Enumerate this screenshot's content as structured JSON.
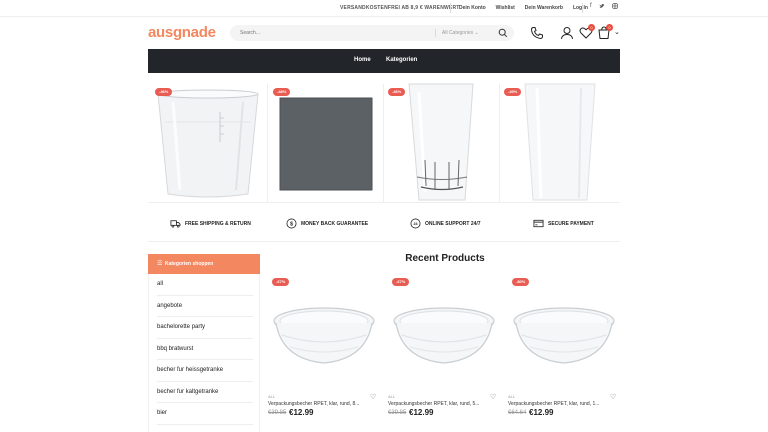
{
  "topbar": {
    "promo": "VERSANDKOSTENFREI AB 8,9 € WARENWERT",
    "links": [
      "Dein Konto",
      "Wishlist",
      "Dein Warenkorb",
      "Log In"
    ],
    "social": [
      "f",
      "t",
      "ig"
    ]
  },
  "header": {
    "logo": "ausgnade",
    "search_placeholder": "Search...",
    "categories_label": "All Categories",
    "wishlist_count": "0",
    "cart_count": "0"
  },
  "nav": {
    "items": [
      "Home",
      "Kategorien"
    ]
  },
  "banner": {
    "sales": [
      "-46%",
      "-48%",
      "-46%",
      "-49%"
    ]
  },
  "features": [
    "FREE SHIPPING & RETURN",
    "MONEY BACK GUARANTEE",
    "ONLINE SUPPORT 24/7",
    "SECURE PAYMENT"
  ],
  "sidebar": {
    "title": "Kategorien shoppen",
    "items": [
      "all",
      "angebote",
      "bachelorette party",
      "bbq bratwurst",
      "becher fur heissgetranke",
      "becher fur kaltgetranke",
      "bier"
    ]
  },
  "recent": {
    "title": "Recent Products",
    "products": [
      {
        "sale": "-67%",
        "category": "ALL",
        "name": "Verpackungsbecher RPET, klar, rund, 8...",
        "old_price": "€39.85",
        "price": "€12.99"
      },
      {
        "sale": "-67%",
        "category": "ALL",
        "name": "Verpackungsbecher RPET, klar, rund, 5...",
        "old_price": "€39.85",
        "price": "€12.99"
      },
      {
        "sale": "-80%",
        "category": "ALL",
        "name": "Verpackungsbecher RPET, klar, rund, 1...",
        "old_price": "€64.64",
        "price": "€12.99"
      }
    ]
  },
  "colors": {
    "accent": "#f28760",
    "nav_bg": "#222529",
    "sale": "#e85c52"
  }
}
